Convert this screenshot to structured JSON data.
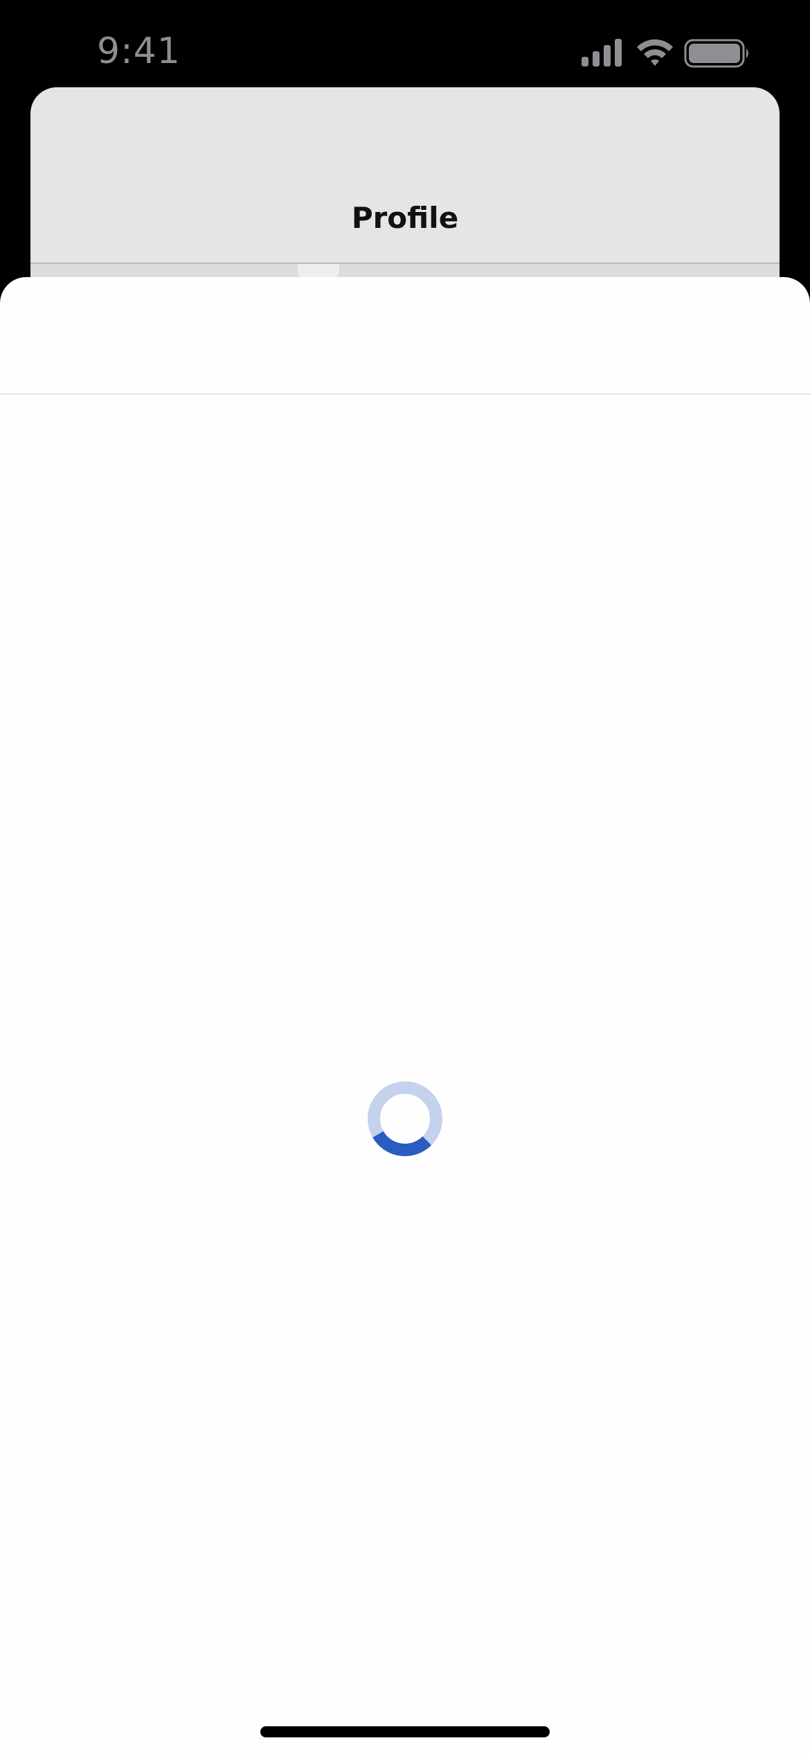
{
  "status_bar": {
    "time": "9:41",
    "icons": [
      "cellular-signal-icon",
      "wifi-icon",
      "battery-icon"
    ]
  },
  "back_sheet": {
    "title": "Profile"
  },
  "front_sheet": {
    "state": "loading",
    "spinner": {
      "track_color": "#c5d2ec",
      "arc_color": "#2b5cbf"
    }
  },
  "colors": {
    "background": "#000000",
    "back_sheet": "#e5e4e7",
    "front_sheet": "#fefefe",
    "status_text": "#8e8e93"
  }
}
